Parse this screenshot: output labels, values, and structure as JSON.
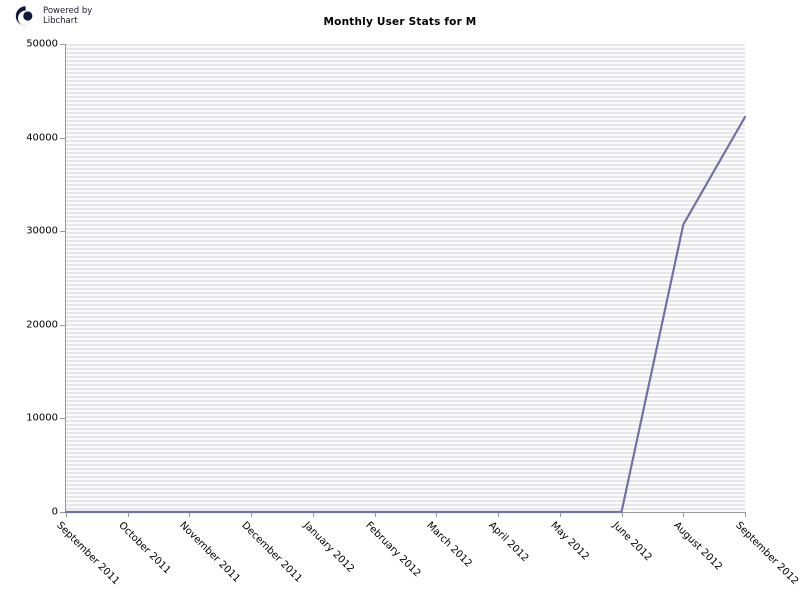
{
  "branding": {
    "logo_icon": "libchart-logo-icon",
    "text": "Powered by\nLibchart"
  },
  "chart_data": {
    "type": "line",
    "title": "Monthly User Stats for M",
    "xlabel": "",
    "ylabel": "",
    "grid": true,
    "legend": "none",
    "line_color": "#7272a8",
    "plot_background": "#ededf0",
    "ylim": [
      0,
      50000
    ],
    "yticks": [
      0,
      10000,
      20000,
      30000,
      40000,
      50000
    ],
    "ytick_labels": [
      "0",
      "10000",
      "20000",
      "30000",
      "40000",
      "50000"
    ],
    "categories": [
      "September 2011",
      "October 2011",
      "November 2011",
      "December 2011",
      "January 2012",
      "February 2012",
      "March 2012",
      "April 2012",
      "May 2012",
      "June 2012",
      "August 2012",
      "September 2012"
    ],
    "values": [
      0,
      0,
      0,
      0,
      0,
      0,
      0,
      0,
      0,
      0,
      30700,
      42200
    ]
  }
}
